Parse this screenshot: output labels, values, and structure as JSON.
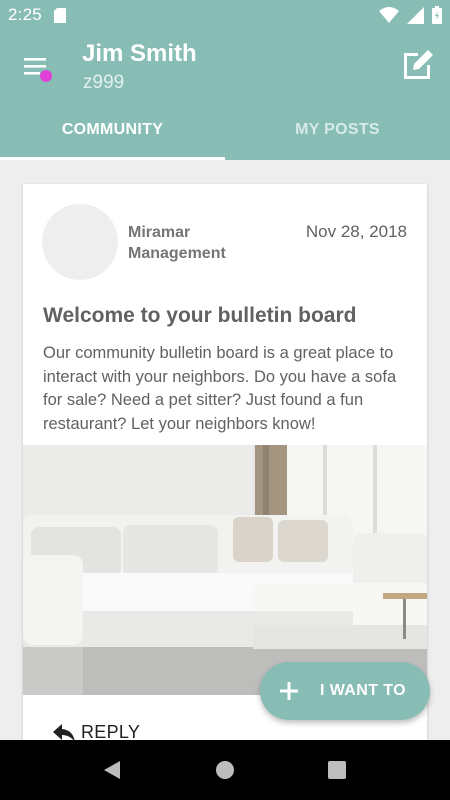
{
  "status_bar": {
    "time": "2:25"
  },
  "app_bar": {
    "user_name": "Jim Smith",
    "user_id": "z999"
  },
  "tabs": [
    {
      "label": "COMMUNITY",
      "active": true
    },
    {
      "label": "MY POSTS",
      "active": false
    }
  ],
  "post": {
    "author": "Miramar Management",
    "date": "Nov 28, 2018",
    "title": "Welcome to your bulletin board",
    "body": "Our community bulletin board is a great place to interact with your neighbors.  Do you have a sofa for sale?  Need a pet sitter?  Just found a fun restaurant?  Let your neighbors know!",
    "reply_label": "REPLY"
  },
  "fab": {
    "label": "I WANT TO"
  },
  "colors": {
    "primary": "#87bdb5",
    "notification_dot": "#e040d6",
    "text_secondary": "#616161"
  }
}
